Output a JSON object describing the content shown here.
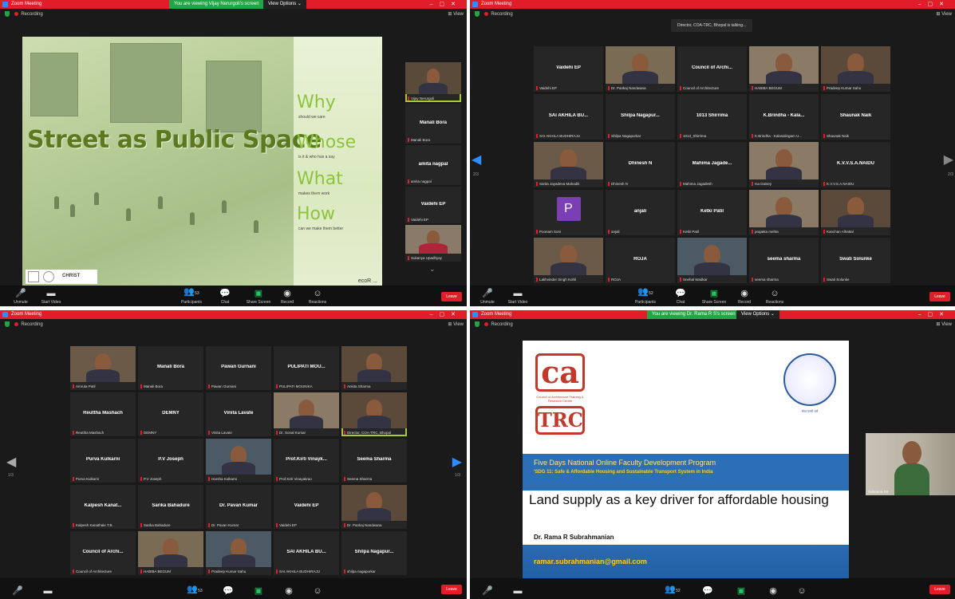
{
  "colors": {
    "title_bar": "#e11d2a",
    "viewing_banner": "#22a544",
    "active_outline": "#a8c93a",
    "accent_green": "#8cc43e",
    "slide_blue": "#2d6fb6"
  },
  "windows": [
    {
      "title": "Zoom Meeting",
      "viewing": "You are viewing Vijay Nerurgoli's screen",
      "view_options": "View Options ⌄",
      "recording": "Recording",
      "view_button": "⊞ View",
      "slide": {
        "headline": "Street as Public Space",
        "questions": [
          {
            "q": "Why",
            "sub": "should we care"
          },
          {
            "q": "Whose",
            "sub": "is it & who has a say"
          },
          {
            "q": "What",
            "sub": "makes them work"
          },
          {
            "q": "How",
            "sub": "can we make them better"
          }
        ],
        "logo_text": "CHRIST",
        "signature": "ecoR ..."
      },
      "side_tiles": [
        {
          "label": "Vijay Nerurgoli",
          "video": true
        },
        {
          "name": "Manali Bora",
          "label": "Manali Bora"
        },
        {
          "name": "amita nagpal",
          "label": "amita nagpal"
        },
        {
          "name": "Vaidehi EP",
          "label": "Vaidehi EP"
        },
        {
          "label": "Sukanya Upadhyay",
          "video": true
        }
      ],
      "toolbar": [
        "Unmute",
        "Start Video",
        "Participants",
        "Chat",
        "Share Screen",
        "Record",
        "Reactions"
      ],
      "participants_count": "53",
      "end": "Leave"
    },
    {
      "title": "Zoom Meeting",
      "recording": "Recording",
      "talking": "Director, COA-TRC, Bhopal is talking...",
      "view_button": "⊞ View",
      "page_left": "2/3",
      "page_right": "2/3",
      "grid": [
        {
          "name": "Vaidehi EP",
          "label": "Vaidehi EP"
        },
        {
          "label": "Dr. Pankaj Nandwana",
          "video": true
        },
        {
          "name": "Council of Archi...",
          "label": "Council of Architecture"
        },
        {
          "label": "HABIBA BEGUM",
          "video": true
        },
        {
          "label": "Pradeep Kumar Sahu",
          "video": true
        },
        {
          "name": "SAI AKHILA BU...",
          "label": "SAI AKHILA BUDHIRAJU"
        },
        {
          "name": "Shilpa Nagapur...",
          "label": "Shilpa Nagapurkar"
        },
        {
          "name": "1013 Shirrima",
          "label": "1013_Shirrima"
        },
        {
          "name": "K.Brindha - Kala...",
          "label": "K.Brindha - Kalasalingam U..."
        },
        {
          "name": "Shaunak Naik",
          "label": "Shaunak Naik"
        },
        {
          "label": "Sarita Jayadeva Mahadik",
          "video": true
        },
        {
          "name": "Dhinesh N",
          "label": "Dhinesh N"
        },
        {
          "name": "Mahima Jagade...",
          "label": "Mahima Jagadesh"
        },
        {
          "label": "Isa Daisey",
          "video": true
        },
        {
          "name": "K.V.V.S.A.NAIDU",
          "label": "K.V.V.S.A.NAIDU"
        },
        {
          "label": "Poonam Soni",
          "avatar": "P"
        },
        {
          "name": "anjali",
          "label": "anjali"
        },
        {
          "name": "Ketki Patil",
          "label": "Ketki Patil"
        },
        {
          "label": "prajakta mehta",
          "video": true
        },
        {
          "label": "Kanchan Alhattal",
          "video": true
        },
        {
          "label": "Lakhvinder Singh Kohli",
          "video": true
        },
        {
          "name": "ROJA",
          "label": "ROJA"
        },
        {
          "label": "Snehal Wadkar",
          "video": true
        },
        {
          "name": "seema sharma",
          "label": "seema sharma"
        },
        {
          "name": "Swati Solunke",
          "label": "Swati Solunke"
        }
      ],
      "toolbar": [
        "Unmute",
        "Start Video",
        "Participants",
        "Chat",
        "Share Screen",
        "Record",
        "Reactions"
      ],
      "participants_count": "52",
      "end": "Leave"
    },
    {
      "title": "Zoom Meeting",
      "recording": "Recording",
      "view_button": "⊞ View",
      "page_left": "1/3",
      "page_right": "1/3",
      "grid": [
        {
          "label": "Amruta Patil",
          "video": true
        },
        {
          "name": "Manali Bora",
          "label": "Manali Bora"
        },
        {
          "name": "Pawan Gurnani",
          "label": "Pawan Gurnani"
        },
        {
          "name": "PULIPATI MOU...",
          "label": "PULIPATI MOUNIKA"
        },
        {
          "label": "Ankita Sharma",
          "video": true
        },
        {
          "name": "Reuttha Mashach",
          "label": "Reuttha Mashach"
        },
        {
          "name": "DEMNY",
          "label": "DEMNY"
        },
        {
          "name": "Vinita Lavate",
          "label": "Vinita Lavate"
        },
        {
          "label": "Dr. Sonal Kumar",
          "video": true
        },
        {
          "label": "Director, COA-TRC, Bhopal",
          "video": true,
          "active": true
        },
        {
          "name": "Purva Kulkarni",
          "label": "Purva Kulkarni"
        },
        {
          "name": "P.V Joseph",
          "label": "P.V Joseph"
        },
        {
          "label": "Harsha Kulkarni",
          "video": true
        },
        {
          "name": "Prof.Kirti Vinayk...",
          "label": "Prof.Kirti Vinayakrao"
        },
        {
          "name": "Seema Sharma",
          "label": "Seema Sharma"
        },
        {
          "name": "Kalpesh Kanat...",
          "label": "Kalpesh Kanathale T.B."
        },
        {
          "name": "Sarika Bahadure",
          "label": "Sarika Bahadure"
        },
        {
          "name": "Dr. Pavan Kumar",
          "label": "Dr. Pavan Kumar"
        },
        {
          "name": "Vaidehi EP",
          "label": "Vaidehi EP"
        },
        {
          "label": "Dr. Pankaj Nandwana",
          "video": true
        },
        {
          "name": "Council of Archi...",
          "label": "Council of Architecture"
        },
        {
          "label": "HABIBA BEGUM",
          "video": true
        },
        {
          "label": "Pradeep Kumar Sahu",
          "video": true
        },
        {
          "name": "SAI AKHILA BU...",
          "label": "SAI AKHILA BUDHIRAJU"
        },
        {
          "name": "Shilpa Nagapur...",
          "label": "shilpa nagapurkar"
        }
      ],
      "participants_count": "53",
      "end": "Leave"
    },
    {
      "title": "Zoom Meeting",
      "viewing": "You are viewing Dr. Rama R S's screen",
      "view_options": "View Options ⌄",
      "recording": "Recording",
      "view_button": "⊞ View",
      "slide": {
        "ca_logo": "ca",
        "ca_sub": "Council of Architecture Training & Research Centre",
        "trc": "TRC",
        "emblem_caption": "सेवा परमो धर्म",
        "program": "Five Days National Online Faculty Development Program",
        "sdg": "'SDG 11: Safe & Affordable Housing and Sustainable Transport System in India",
        "title": "Land supply as a key driver for affordable housing",
        "speaker": "Dr. Rama R Subrahmanian",
        "email": "ramar.subrahmanian@gmail.com"
      },
      "presenter_label": "Subrama SS",
      "participants_count": "52",
      "end": "Leave"
    }
  ]
}
